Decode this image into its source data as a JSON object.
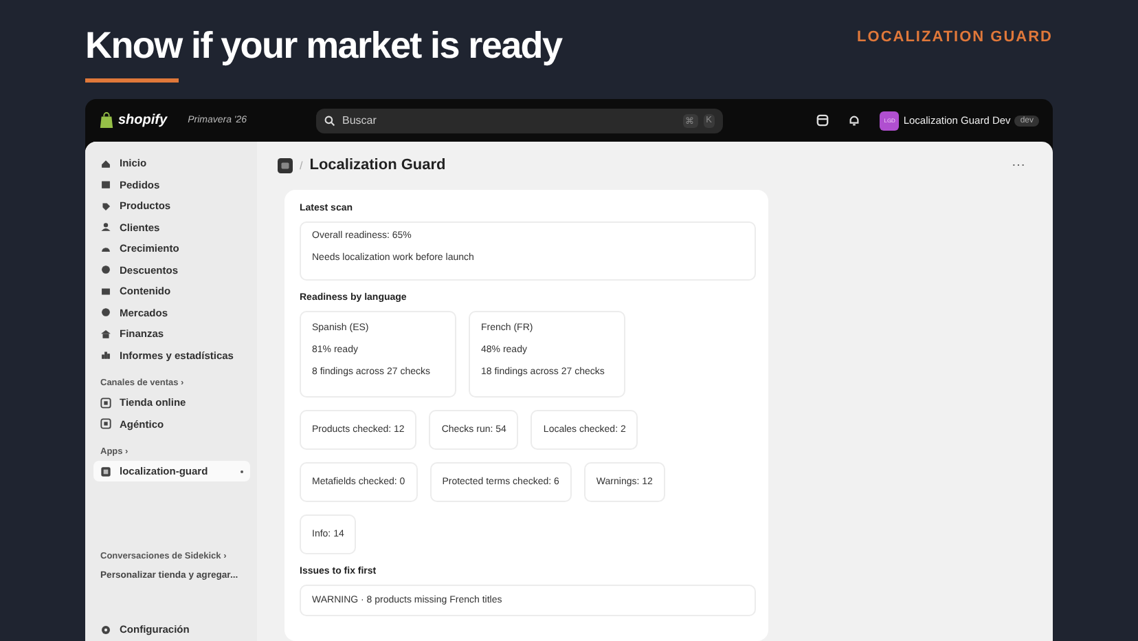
{
  "header": {
    "title": "Know if your market is ready",
    "label": "LOCALIZATION GUARD"
  },
  "topbar": {
    "brand": "shopify",
    "season": "Primavera '26",
    "search": {
      "placeholder": "Buscar"
    },
    "shortcut": [
      "⌘",
      "K"
    ],
    "avatar": "LGD",
    "store": "Localization Guard Dev",
    "badge": "dev"
  },
  "sidebar": {
    "items": [
      {
        "label": "Inicio",
        "selected": false
      },
      {
        "label": "Pedidos",
        "selected": false
      },
      {
        "label": "Productos",
        "selected": false
      },
      {
        "label": "Clientes",
        "selected": false
      },
      {
        "label": "Crecimiento",
        "selected": false
      },
      {
        "label": "Descuentos",
        "selected": false
      },
      {
        "label": "Contenido",
        "selected": false
      },
      {
        "label": "Mercados",
        "selected": false
      },
      {
        "label": "Finanzas",
        "selected": false
      },
      {
        "label": "Informes y estadísticas",
        "selected": false
      }
    ],
    "sales_channels": {
      "title": "Canales de ventas ›",
      "items": [
        {
          "label": "Tienda online",
          "selected": false
        },
        {
          "label": "Agéntico",
          "selected": false
        }
      ]
    },
    "apps": {
      "title": "Apps ›",
      "items": [
        {
          "label": "localization-guard",
          "selected": true
        }
      ]
    },
    "sidekick": {
      "title": "Conversaciones de Sidekick ›",
      "items": [
        "Personalizar tienda y agregar..."
      ]
    },
    "settings": "Configuración"
  },
  "page": {
    "separator": "/",
    "title": "Localization Guard",
    "menu": "⋯",
    "latest_scan": {
      "heading": "Latest scan",
      "lines": [
        "Overall readiness: 65%",
        "Needs localization work before launch"
      ]
    },
    "languages": {
      "heading": "Readiness by language",
      "cards": [
        {
          "name": "Spanish (ES)",
          "ready": "81% ready",
          "findings": "8 findings across 27 checks"
        },
        {
          "name": "French (FR)",
          "ready": "48% ready",
          "findings": "18 findings across 27 checks"
        }
      ]
    },
    "stats": [
      "Products checked: 12",
      "Checks run: 54",
      "Locales checked: 2",
      "Metafields checked: 0",
      "Protected terms checked: 6",
      "Warnings: 12",
      "Info: 14"
    ],
    "issues": {
      "heading": "Issues to fix first",
      "items": [
        "WARNING · 8 products missing French titles"
      ]
    }
  }
}
